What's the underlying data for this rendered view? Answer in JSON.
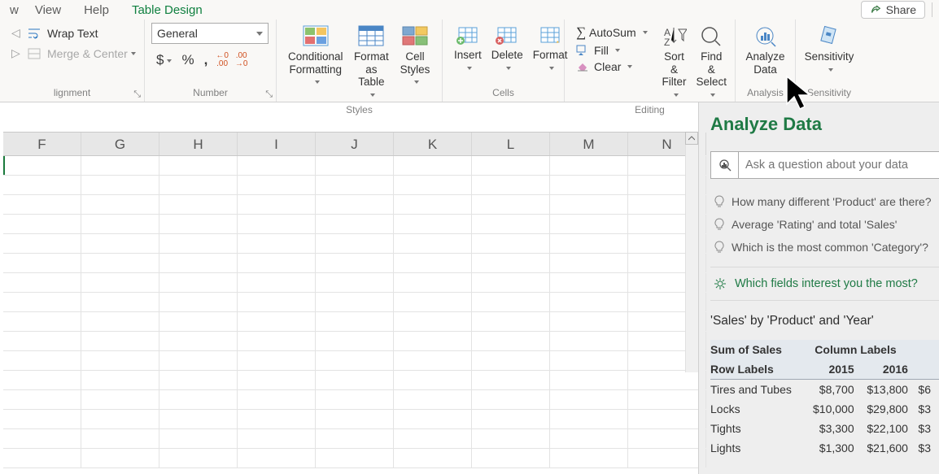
{
  "menu": {
    "view": "View",
    "help": "Help",
    "tabledesign": "Table Design"
  },
  "share_label": "Share",
  "alignment": {
    "wrap": "Wrap Text",
    "merge": "Merge & Center",
    "group": "lignment"
  },
  "number": {
    "format": "General",
    "group": "Number"
  },
  "styles": {
    "cond": "Conditional\nFormatting",
    "fmttable": "Format as\nTable",
    "cellstyles": "Cell\nStyles",
    "group": "Styles"
  },
  "cells": {
    "insert": "Insert",
    "delete": "Delete",
    "format": "Format",
    "group": "Cells"
  },
  "editing": {
    "autosum": "AutoSum",
    "fill": "Fill",
    "clear": "Clear",
    "sortfilter": "Sort &\nFilter",
    "findselect": "Find &\nSelect",
    "group": "Editing"
  },
  "analysis": {
    "analyze": "Analyze\nData",
    "group": "Analysis"
  },
  "sensitivity": {
    "label": "Sensitivity",
    "group": "Sensitivity"
  },
  "columns": [
    "F",
    "G",
    "H",
    "I",
    "J",
    "K",
    "L",
    "M",
    "N"
  ],
  "pane": {
    "title": "Analyze Data",
    "placeholder": "Ask a question about your data",
    "suggestions": [
      "How many different 'Product' are there?",
      "Average 'Rating' and total 'Sales'",
      "Which is the most common 'Category'?"
    ],
    "interest": "Which fields interest you the most?",
    "insight_title": "'Sales' by 'Product' and 'Year'",
    "pivot": {
      "corner": "Sum of Sales",
      "collabel": "Column Labels",
      "rowlabel": "Row Labels",
      "cols": [
        "2015",
        "2016"
      ],
      "rows": [
        {
          "label": "Tires and Tubes",
          "vals": [
            "$8,700",
            "$13,800",
            "$6"
          ]
        },
        {
          "label": "Locks",
          "vals": [
            "$10,000",
            "$29,800",
            "$3"
          ]
        },
        {
          "label": "Tights",
          "vals": [
            "$3,300",
            "$22,100",
            "$3"
          ]
        },
        {
          "label": "Lights",
          "vals": [
            "$1,300",
            "$21,600",
            "$3"
          ]
        }
      ]
    }
  }
}
